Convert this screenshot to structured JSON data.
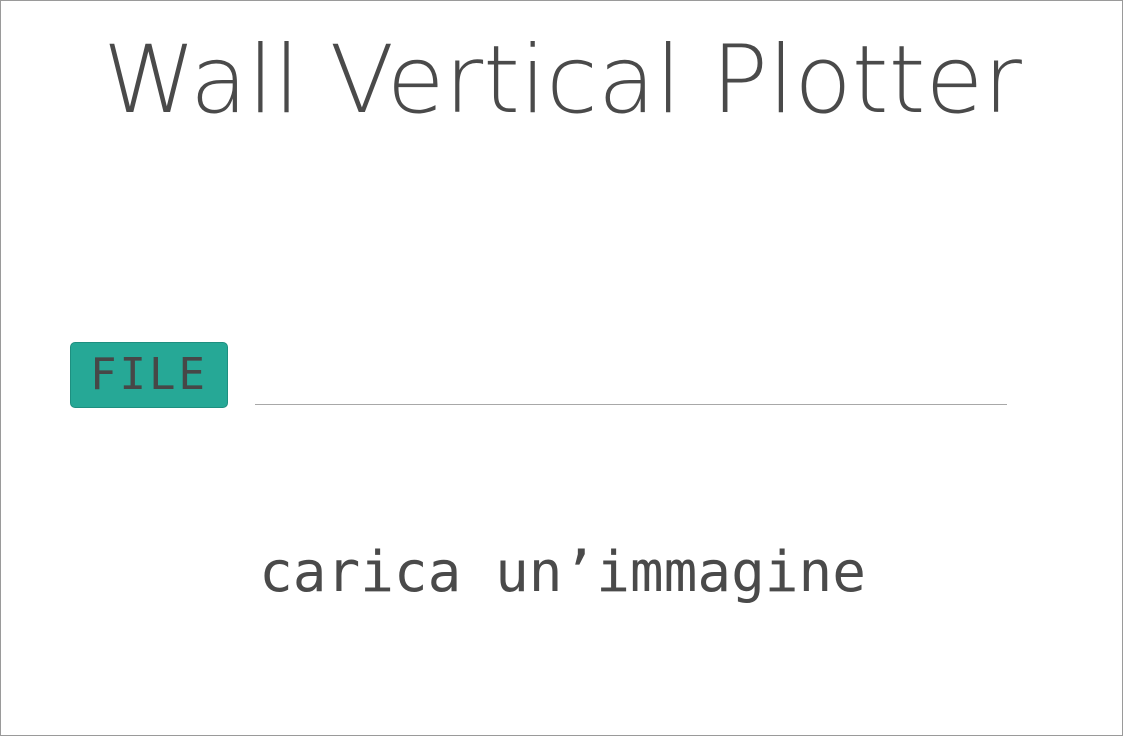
{
  "header": {
    "title": "Wall Vertical Plotter"
  },
  "upload": {
    "button_label": "FILE",
    "path_value": "",
    "path_placeholder": ""
  },
  "hint": {
    "text": "carica un’immagine"
  },
  "colors": {
    "accent": "#26a896",
    "text": "#4a4a4a",
    "border": "#9a9a9a"
  }
}
